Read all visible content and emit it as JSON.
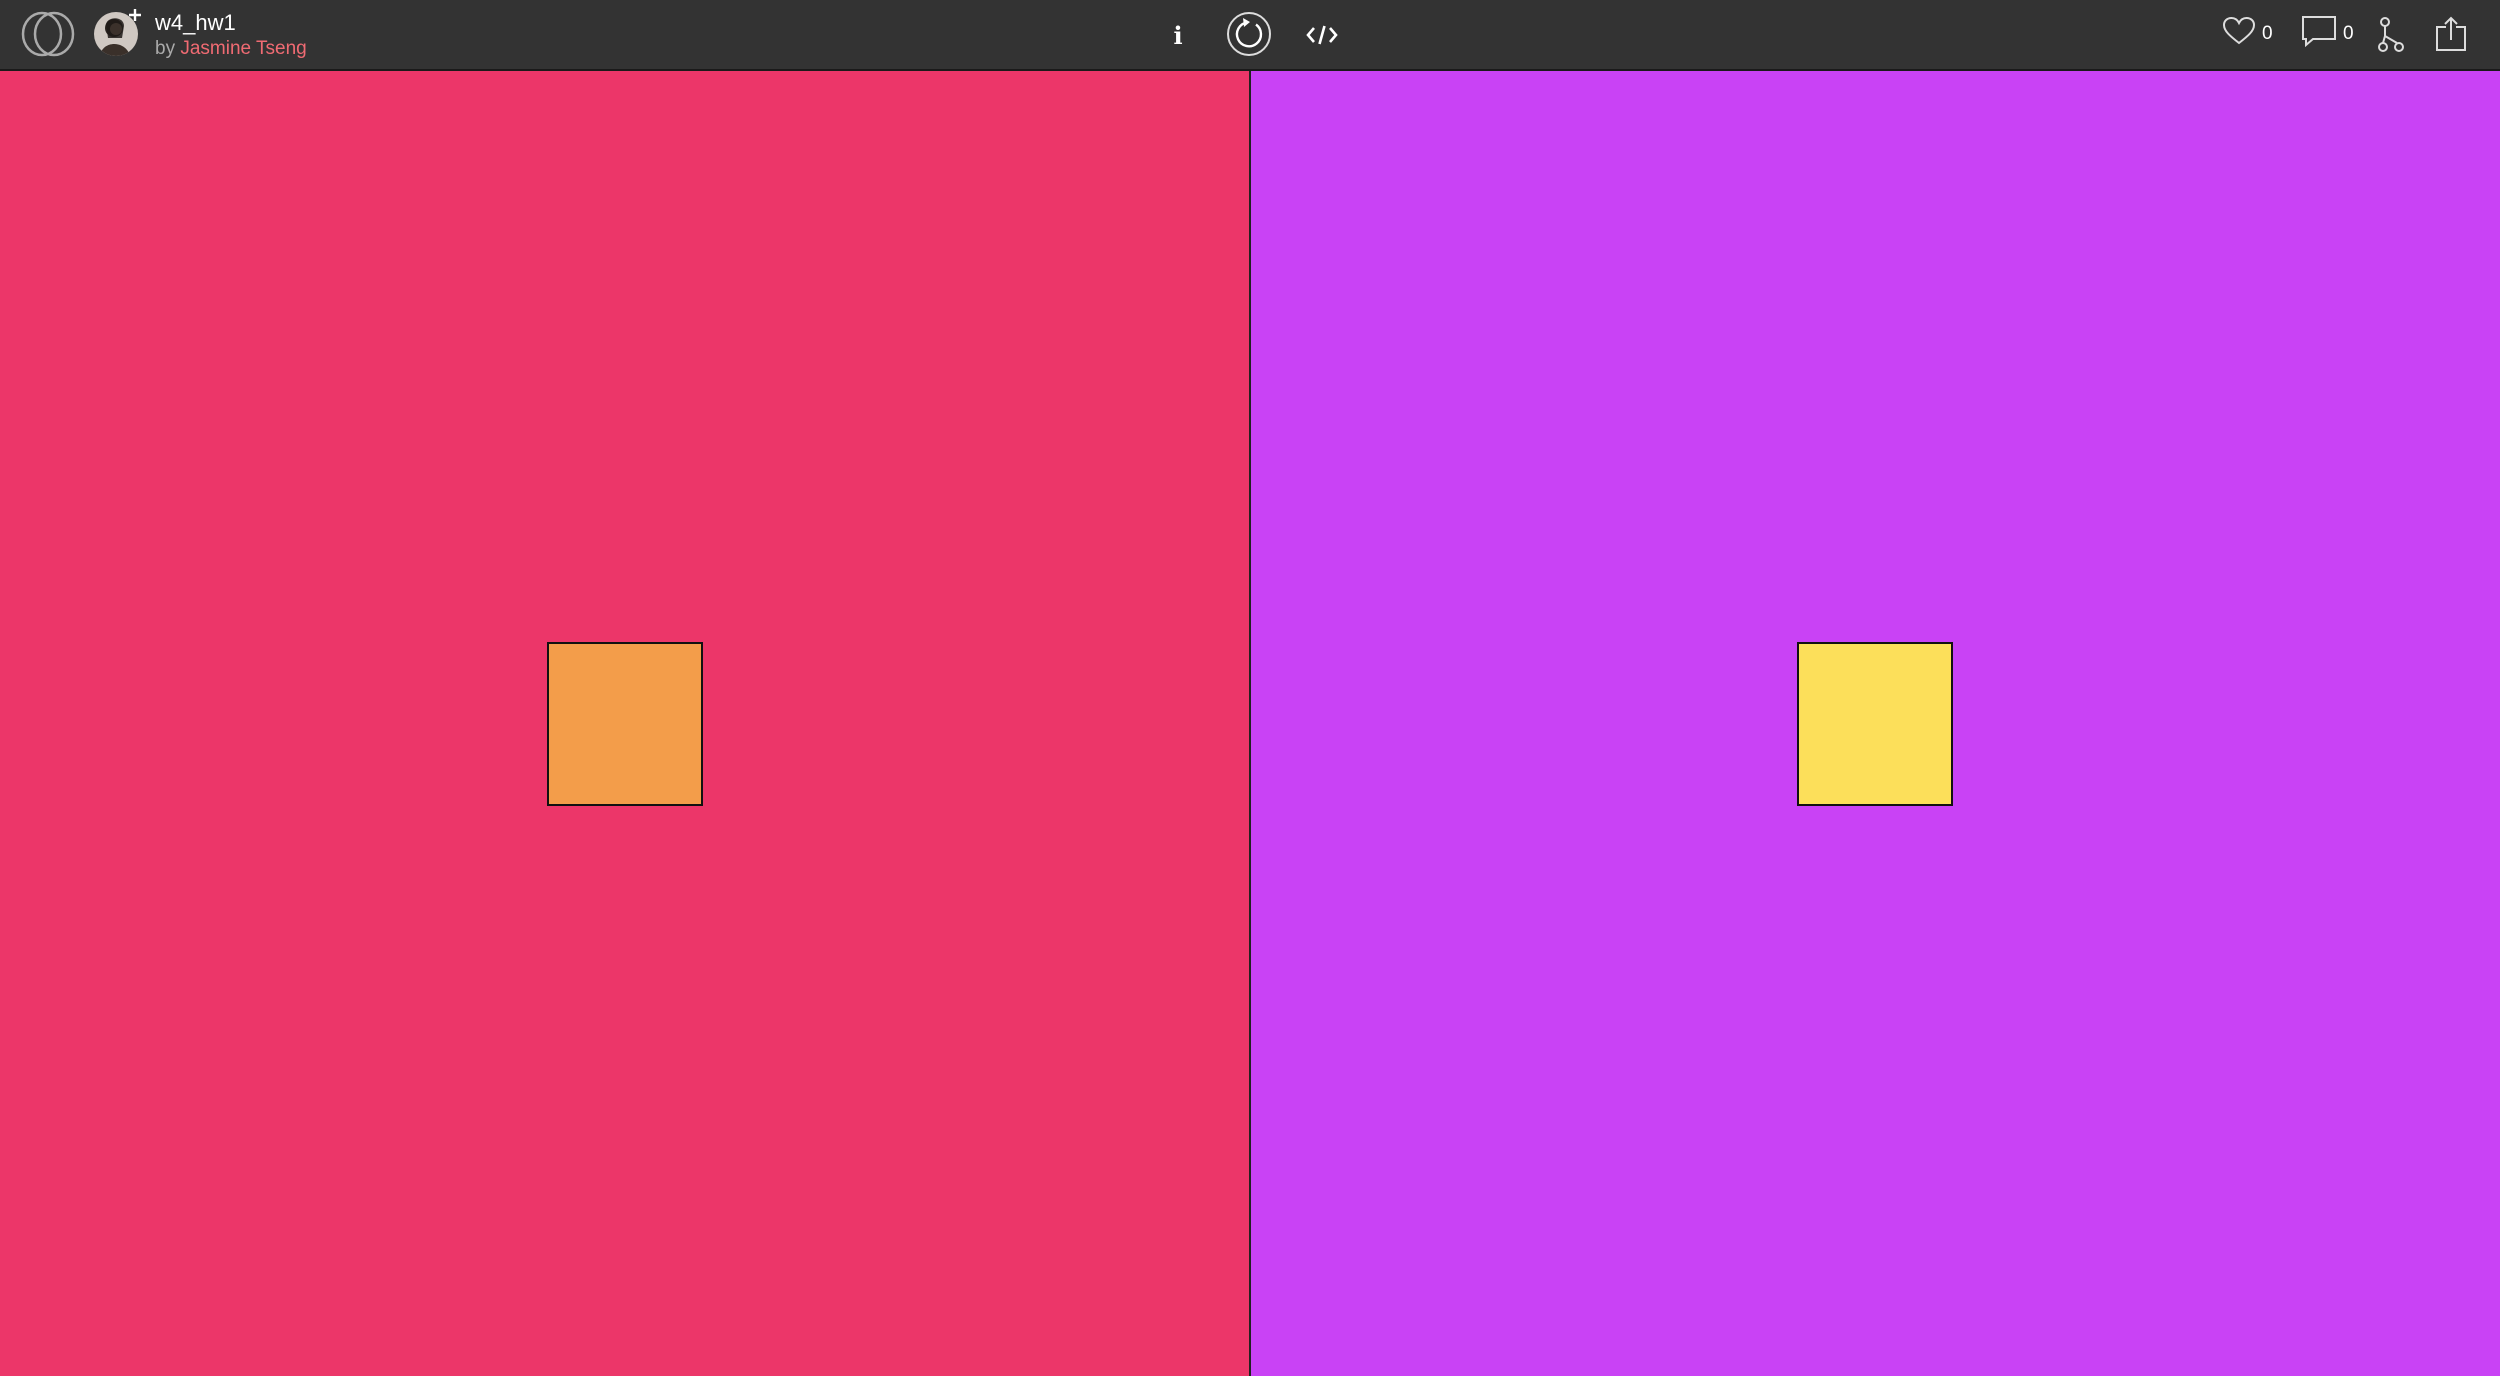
{
  "header": {
    "sketch_title": "w4_hw1",
    "by_prefix": "by ",
    "author": "Jasmine Tseng",
    "info_label": "i",
    "hearts_count": "0",
    "comments_count": "0"
  },
  "icons": {
    "logo": "openprocessing-logo-icon",
    "avatar": "user-avatar",
    "info": "info-icon",
    "restart": "restart-icon",
    "code": "code-icon",
    "heart": "heart-icon",
    "comment": "comment-icon",
    "fork": "fork-icon",
    "share": "share-icon"
  },
  "canvas": {
    "left_background": "#EC3669",
    "right_background": "#C942F5",
    "left_square_color": "#F39D4A",
    "right_square_color": "#FCDF5A",
    "square_border": "#111111"
  },
  "colors": {
    "topbar": "#333333",
    "author_link": "#F06B73"
  }
}
